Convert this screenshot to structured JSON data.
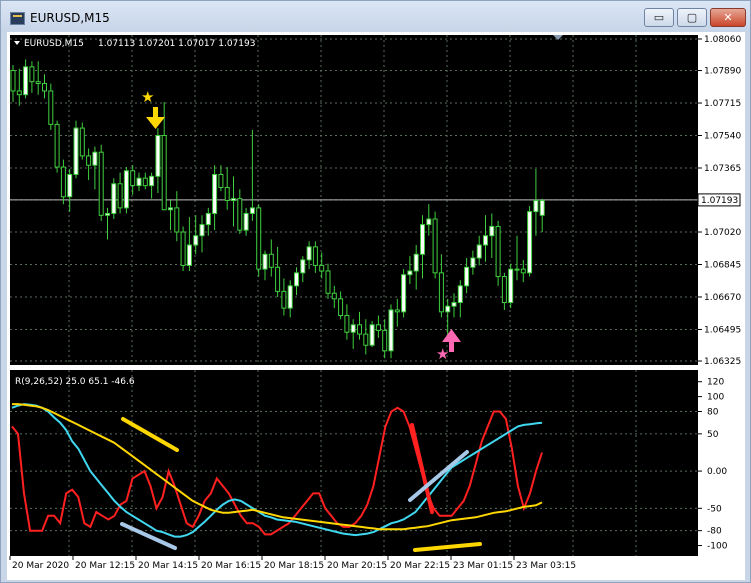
{
  "window": {
    "title": "EURUSD,M15",
    "buttons": {
      "minimize": "▭",
      "maximize": "▢",
      "close": "✕"
    }
  },
  "chart_data": [
    {
      "type": "candlestick",
      "symbol_label": "EURUSD,M15",
      "ohlc_label": "1.07113 1.07201 1.07017 1.07193",
      "current_price": "1.07193",
      "y_ticks": [
        "1.08060",
        "1.07890",
        "1.07715",
        "1.07540",
        "1.07365",
        "1.07193",
        "1.07020",
        "1.06845",
        "1.06670",
        "1.06495",
        "1.06325"
      ],
      "ylim": [
        1.06325,
        1.0806
      ],
      "x_ticks": [
        "20 Mar 2020",
        "20 Mar 12:15",
        "20 Mar 14:15",
        "20 Mar 16:15",
        "20 Mar 18:15",
        "20 Mar 20:15",
        "20 Mar 22:15",
        "23 Mar 01:15",
        "23 Mar 03:15"
      ],
      "candles": [
        [
          1.0789,
          1.0792,
          1.0772,
          1.0778
        ],
        [
          1.0778,
          1.079,
          1.077,
          1.0776
        ],
        [
          1.0776,
          1.0795,
          1.0774,
          1.0791
        ],
        [
          1.0791,
          1.0794,
          1.0777,
          1.0783
        ],
        [
          1.0783,
          1.0794,
          1.0776,
          1.0782
        ],
        [
          1.0782,
          1.0787,
          1.0774,
          1.0778
        ],
        [
          1.0778,
          1.0782,
          1.0757,
          1.076
        ],
        [
          1.076,
          1.0762,
          1.0734,
          1.0737
        ],
        [
          1.0737,
          1.0741,
          1.0717,
          1.0721
        ],
        [
          1.0721,
          1.0736,
          1.0713,
          1.0733
        ],
        [
          1.0733,
          1.0762,
          1.0731,
          1.0758
        ],
        [
          1.0758,
          1.0761,
          1.0741,
          1.0743
        ],
        [
          1.0743,
          1.0747,
          1.073,
          1.0738
        ],
        [
          1.0738,
          1.0748,
          1.0725,
          1.0745
        ],
        [
          1.0745,
          1.0749,
          1.0708,
          1.0711
        ],
        [
          1.0711,
          1.0715,
          1.0698,
          1.0712
        ],
        [
          1.0712,
          1.0731,
          1.0709,
          1.0728
        ],
        [
          1.0728,
          1.0734,
          1.0712,
          1.0715
        ],
        [
          1.0715,
          1.0737,
          1.0712,
          1.0735
        ],
        [
          1.0735,
          1.0738,
          1.0722,
          1.0727
        ],
        [
          1.0727,
          1.0734,
          1.0724,
          1.0731
        ],
        [
          1.0731,
          1.0734,
          1.0725,
          1.0727
        ],
        [
          1.0727,
          1.0734,
          1.072,
          1.0732
        ],
        [
          1.0732,
          1.0758,
          1.0723,
          1.0754
        ],
        [
          1.0754,
          1.0772,
          1.0724,
          1.0714
        ],
        [
          1.0714,
          1.0719,
          1.0703,
          1.0715
        ],
        [
          1.0715,
          1.0724,
          1.0697,
          1.0702
        ],
        [
          1.0702,
          1.0705,
          1.0681,
          1.0684
        ],
        [
          1.0684,
          1.071,
          1.0681,
          1.0695
        ],
        [
          1.0695,
          1.0711,
          1.069,
          1.07
        ],
        [
          1.07,
          1.0711,
          1.0691,
          1.0706
        ],
        [
          1.0706,
          1.0715,
          1.07,
          1.0712
        ],
        [
          1.0712,
          1.0738,
          1.0703,
          1.0733
        ],
        [
          1.0733,
          1.0738,
          1.0724,
          1.0726
        ],
        [
          1.0726,
          1.0737,
          1.0714,
          1.0719
        ],
        [
          1.0719,
          1.0732,
          1.0705,
          1.072
        ],
        [
          1.072,
          1.0725,
          1.0701,
          1.0703
        ],
        [
          1.0703,
          1.0715,
          1.07,
          1.0712
        ],
        [
          1.0712,
          1.0757,
          1.0708,
          1.0715
        ],
        [
          1.0715,
          1.0717,
          1.0678,
          1.0682
        ],
        [
          1.0682,
          1.0692,
          1.0676,
          1.069
        ],
        [
          1.069,
          1.0698,
          1.0678,
          1.0683
        ],
        [
          1.0683,
          1.0694,
          1.0667,
          1.067
        ],
        [
          1.067,
          1.0677,
          1.0657,
          1.0661
        ],
        [
          1.0661,
          1.0676,
          1.0656,
          1.0673
        ],
        [
          1.0673,
          1.0683,
          1.0668,
          1.068
        ],
        [
          1.068,
          1.0689,
          1.0675,
          1.0687
        ],
        [
          1.0687,
          1.0697,
          1.0682,
          1.0694
        ],
        [
          1.0694,
          1.0697,
          1.068,
          1.0684
        ],
        [
          1.0684,
          1.0691,
          1.0677,
          1.0681
        ],
        [
          1.0681,
          1.0685,
          1.0666,
          1.0669
        ],
        [
          1.0669,
          1.0673,
          1.0661,
          1.0666
        ],
        [
          1.0666,
          1.067,
          1.0655,
          1.0657
        ],
        [
          1.0657,
          1.0663,
          1.0644,
          1.0648
        ],
        [
          1.0648,
          1.0655,
          1.0639,
          1.0652
        ],
        [
          1.0652,
          1.0659,
          1.0644,
          1.0647
        ],
        [
          1.0647,
          1.0655,
          1.0636,
          1.0641
        ],
        [
          1.0641,
          1.0654,
          1.064,
          1.0652
        ],
        [
          1.0652,
          1.0657,
          1.0645,
          1.0649
        ],
        [
          1.0649,
          1.0655,
          1.0634,
          1.0638
        ],
        [
          1.0638,
          1.0663,
          1.0634,
          1.066
        ],
        [
          1.066,
          1.0666,
          1.0651,
          1.0659
        ],
        [
          1.0659,
          1.0682,
          1.0656,
          1.0679
        ],
        [
          1.0679,
          1.0689,
          1.0674,
          1.0681
        ],
        [
          1.0681,
          1.0695,
          1.0671,
          1.069
        ],
        [
          1.069,
          1.0711,
          1.0677,
          1.0706
        ],
        [
          1.0706,
          1.0717,
          1.07,
          1.0709
        ],
        [
          1.0709,
          1.0713,
          1.0677,
          1.068
        ],
        [
          1.068,
          1.069,
          1.0656,
          1.0659
        ],
        [
          1.0659,
          1.0666,
          1.0644,
          1.0662
        ],
        [
          1.0662,
          1.0669,
          1.0656,
          1.0664
        ],
        [
          1.0664,
          1.0676,
          1.0656,
          1.0673
        ],
        [
          1.0673,
          1.0688,
          1.0669,
          1.0683
        ],
        [
          1.0683,
          1.0692,
          1.0679,
          1.0688
        ],
        [
          1.0688,
          1.07,
          1.0684,
          1.0695
        ],
        [
          1.0695,
          1.0711,
          1.0686,
          1.07
        ],
        [
          1.07,
          1.0712,
          1.0688,
          1.0705
        ],
        [
          1.0705,
          1.0708,
          1.0673,
          1.0678
        ],
        [
          1.0678,
          1.068,
          1.066,
          1.0664
        ],
        [
          1.0664,
          1.0685,
          1.0661,
          1.0682
        ],
        [
          1.0682,
          1.07,
          1.0676,
          1.0682
        ],
        [
          1.0682,
          1.0687,
          1.0675,
          1.068
        ],
        [
          1.068,
          1.0716,
          1.0678,
          1.0713
        ],
        [
          1.0713,
          1.0736,
          1.07,
          1.0719
        ],
        [
          1.0711,
          1.072,
          1.0702,
          1.0719
        ]
      ],
      "annotations": [
        {
          "kind": "sell-arrow",
          "index": 8,
          "color": "#ffd700"
        },
        {
          "kind": "buy-arrow",
          "index": 59,
          "color": "#ff69b4"
        }
      ]
    },
    {
      "type": "line",
      "indicator_label": "R(9,26,52) 25.0 65.1 -46.6",
      "y_ticks": [
        "120",
        "100",
        "80",
        "50",
        "0.00",
        "-50",
        "-80",
        "-100"
      ],
      "ylim": [
        -110,
        125
      ],
      "series": [
        {
          "color": "#ff2020",
          "values": [
            60,
            50,
            -30,
            -80,
            -80,
            -80,
            -60,
            -60,
            -70,
            -30,
            -25,
            -35,
            -70,
            -75,
            -55,
            -60,
            -65,
            -60,
            -45,
            -40,
            -10,
            -5,
            0,
            -20,
            -50,
            -35,
            0,
            -20,
            -45,
            -70,
            -75,
            -60,
            -40,
            -30,
            -10,
            -20,
            -30,
            -45,
            -60,
            -70,
            -70,
            -75,
            -85,
            -85,
            -80,
            -75,
            -70,
            -60,
            -50,
            -40,
            -30,
            -30,
            -50,
            -60,
            -70,
            -75,
            -75,
            -70,
            -60,
            -45,
            -20,
            20,
            60,
            80,
            85,
            80,
            60,
            30,
            0,
            -30,
            -50,
            -60,
            -60,
            -60,
            -50,
            -40,
            -20,
            10,
            40,
            60,
            80,
            80,
            70,
            30,
            -20,
            -50,
            -30,
            0,
            25
          ]
        },
        {
          "color": "#40d8f0",
          "values": [
            85,
            88,
            90,
            89,
            88,
            85,
            80,
            72,
            65,
            55,
            40,
            30,
            15,
            0,
            -10,
            -20,
            -30,
            -40,
            -48,
            -55,
            -60,
            -65,
            -70,
            -75,
            -80,
            -82,
            -85,
            -88,
            -88,
            -86,
            -82,
            -75,
            -68,
            -60,
            -52,
            -45,
            -40,
            -38,
            -40,
            -45,
            -50,
            -55,
            -60,
            -62,
            -65,
            -66,
            -67,
            -68,
            -70,
            -72,
            -74,
            -76,
            -78,
            -80,
            -82,
            -84,
            -85,
            -86,
            -85,
            -84,
            -82,
            -78,
            -74,
            -70,
            -68,
            -65,
            -60,
            -55,
            -45,
            -35,
            -25,
            -15,
            -5,
            5,
            10,
            15,
            20,
            25,
            30,
            35,
            40,
            45,
            50,
            55,
            60,
            62,
            63,
            64,
            65
          ]
        },
        {
          "color": "#ffd700",
          "values": [
            90,
            90,
            89,
            88,
            87,
            85,
            82,
            78,
            74,
            70,
            66,
            62,
            58,
            54,
            50,
            46,
            42,
            38,
            32,
            26,
            20,
            14,
            8,
            2,
            -4,
            -10,
            -16,
            -22,
            -28,
            -34,
            -40,
            -44,
            -48,
            -52,
            -54,
            -56,
            -56,
            -55,
            -54,
            -53,
            -52,
            -54,
            -56,
            -58,
            -60,
            -62,
            -63,
            -64,
            -65,
            -66,
            -67,
            -68,
            -69,
            -70,
            -71,
            -72,
            -73,
            -74,
            -75,
            -76,
            -77,
            -78,
            -78,
            -78,
            -78,
            -78,
            -77,
            -76,
            -75,
            -74,
            -72,
            -70,
            -68,
            -66,
            -65,
            -64,
            -63,
            -62,
            -60,
            -58,
            -56,
            -55,
            -54,
            -52,
            -50,
            -48,
            -47,
            -46,
            -42
          ]
        }
      ]
    }
  ],
  "colors": {
    "background": "#000000",
    "grid": "#5a6e5a",
    "bull_candle": "#ffffff",
    "bear_candle": "#000000",
    "wick": "#3fd03f",
    "price_line": "#bbbbbb"
  }
}
